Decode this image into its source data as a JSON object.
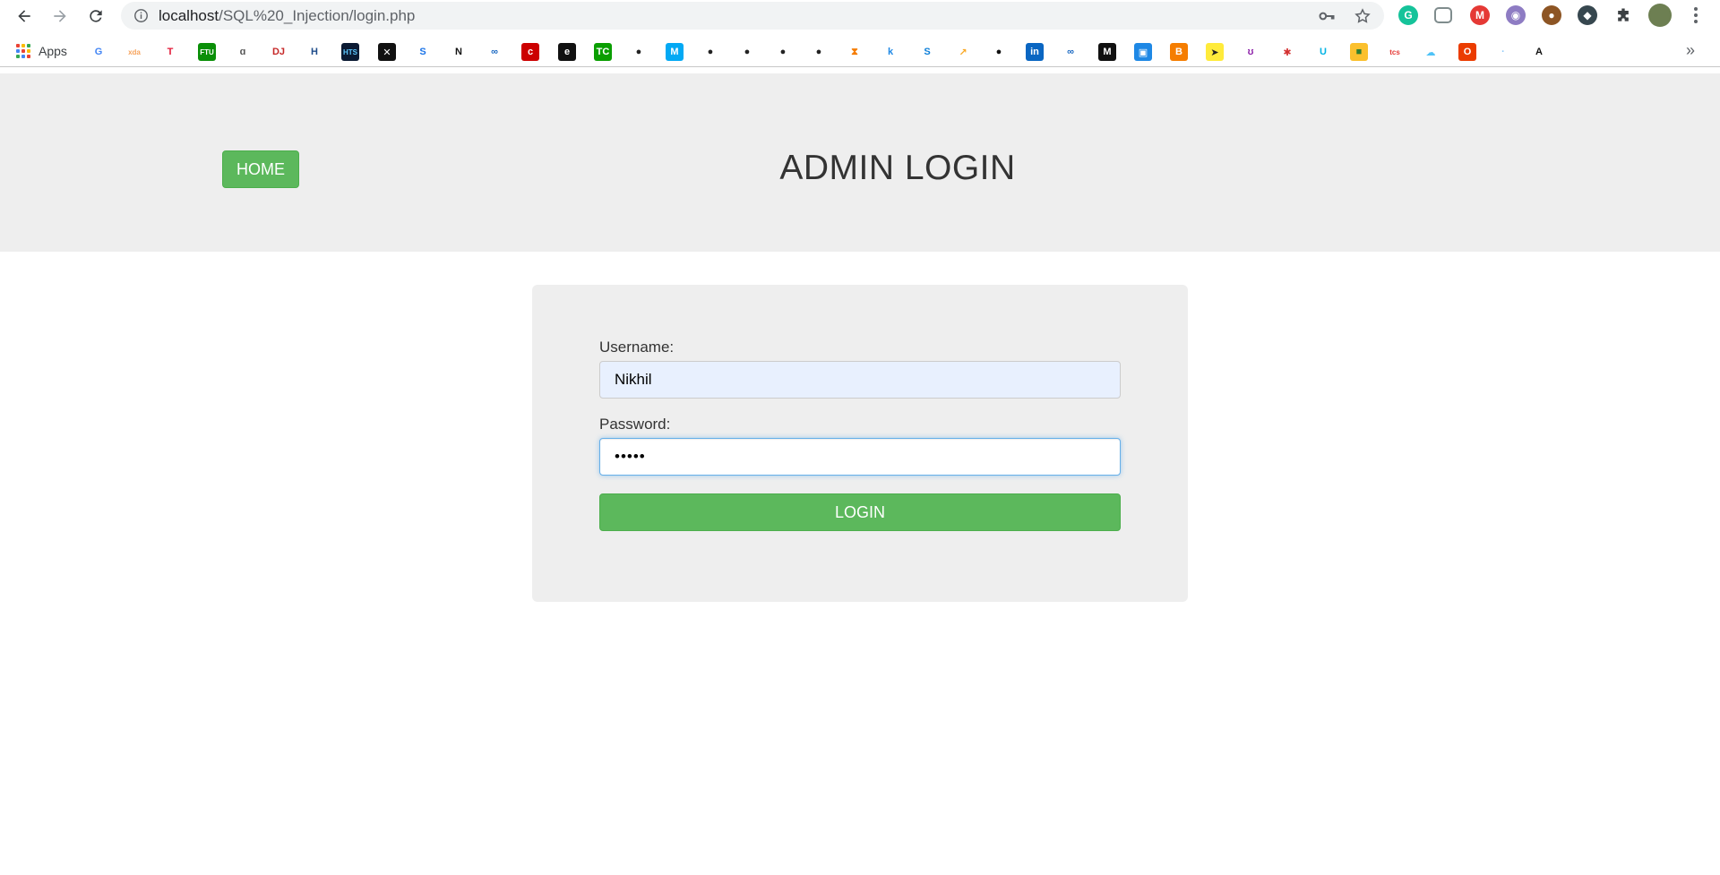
{
  "browser": {
    "url_host": "localhost",
    "url_path": "/SQL%20_Injection/login.php",
    "apps_label": "Apps",
    "more_label": "»"
  },
  "bookmarks": [
    {
      "name": "google",
      "glyph": "G",
      "bg": "#ffffff",
      "fg": "#4285f4"
    },
    {
      "name": "xda",
      "glyph": "xda",
      "bg": "#ffffff",
      "fg": "#f7a35c"
    },
    {
      "name": "tesla",
      "glyph": "T",
      "bg": "#ffffff",
      "fg": "#e31937"
    },
    {
      "name": "ftu",
      "glyph": "FTU",
      "bg": "#0a8f08",
      "fg": "#ffffff"
    },
    {
      "name": "grammarly-go",
      "glyph": "ɑ",
      "bg": "#ffffff",
      "fg": "#555555"
    },
    {
      "name": "dj",
      "glyph": "DJ",
      "bg": "#ffffff",
      "fg": "#c62828"
    },
    {
      "name": "h-tile",
      "glyph": "H",
      "bg": "#ffffff",
      "fg": "#1e4c8a"
    },
    {
      "name": "hts",
      "glyph": "HTS",
      "bg": "#0b1a33",
      "fg": "#5ec8ff"
    },
    {
      "name": "x-tile",
      "glyph": "✕",
      "bg": "#111111",
      "fg": "#ffffff"
    },
    {
      "name": "s-tile",
      "glyph": "S",
      "bg": "#ffffff",
      "fg": "#1a73e8"
    },
    {
      "name": "n-tile",
      "glyph": "N",
      "bg": "#ffffff",
      "fg": "#111111"
    },
    {
      "name": "infinity-1",
      "glyph": "∞",
      "bg": "#ffffff",
      "fg": "#1565c0"
    },
    {
      "name": "c-tile",
      "glyph": "c",
      "bg": "#cc0000",
      "fg": "#ffffff"
    },
    {
      "name": "e-tile",
      "glyph": "e",
      "bg": "#111111",
      "fg": "#ffffff"
    },
    {
      "name": "techcrunch",
      "glyph": "TC",
      "bg": "#0a9e01",
      "fg": "#ffffff"
    },
    {
      "name": "globe-1",
      "glyph": "●",
      "bg": "#ffffff",
      "fg": "#222222"
    },
    {
      "name": "m-tile",
      "glyph": "M",
      "bg": "#03a9f4",
      "fg": "#ffffff"
    },
    {
      "name": "globe-2",
      "glyph": "●",
      "bg": "#ffffff",
      "fg": "#222222"
    },
    {
      "name": "globe-3",
      "glyph": "●",
      "bg": "#ffffff",
      "fg": "#222222"
    },
    {
      "name": "globe-4",
      "glyph": "●",
      "bg": "#ffffff",
      "fg": "#222222"
    },
    {
      "name": "globe-5",
      "glyph": "●",
      "bg": "#ffffff",
      "fg": "#222222"
    },
    {
      "name": "hourglass",
      "glyph": "⧗",
      "bg": "#ffffff",
      "fg": "#f57c00"
    },
    {
      "name": "k-tile",
      "glyph": "k",
      "bg": "#ffffff",
      "fg": "#1e88e5"
    },
    {
      "name": "s-blue",
      "glyph": "S",
      "bg": "#ffffff",
      "fg": "#0d7fd8"
    },
    {
      "name": "arrow-tile",
      "glyph": "↗",
      "bg": "#ffffff",
      "fg": "#f9a825"
    },
    {
      "name": "github",
      "glyph": "●",
      "bg": "#ffffff",
      "fg": "#111111"
    },
    {
      "name": "linkedin",
      "glyph": "in",
      "bg": "#0a66c2",
      "fg": "#ffffff"
    },
    {
      "name": "infinity-2",
      "glyph": "∞",
      "bg": "#ffffff",
      "fg": "#1565c0"
    },
    {
      "name": "medium",
      "glyph": "M",
      "bg": "#111111",
      "fg": "#ffffff"
    },
    {
      "name": "id-tile",
      "glyph": "▣",
      "bg": "#1e88e5",
      "fg": "#ffffff"
    },
    {
      "name": "blogger",
      "glyph": "B",
      "bg": "#f57d00",
      "fg": "#ffffff"
    },
    {
      "name": "send-tile",
      "glyph": "➤",
      "bg": "#ffeb3b",
      "fg": "#222222"
    },
    {
      "name": "purple-tile",
      "glyph": "ʊ",
      "bg": "#ffffff",
      "fg": "#8e24aa"
    },
    {
      "name": "red-tile",
      "glyph": "✱",
      "bg": "#ffffff",
      "fg": "#d32f2f"
    },
    {
      "name": "udacity",
      "glyph": "U",
      "bg": "#ffffff",
      "fg": "#02b3e4"
    },
    {
      "name": "yellow-tile",
      "glyph": "■",
      "bg": "#fbc02d",
      "fg": "#2e7d32"
    },
    {
      "name": "tcs",
      "glyph": "tcs",
      "bg": "#ffffff",
      "fg": "#e53935"
    },
    {
      "name": "cloud-tile",
      "glyph": "☁",
      "bg": "#ffffff",
      "fg": "#4fc3f7"
    },
    {
      "name": "office",
      "glyph": "O",
      "bg": "#eb3c00",
      "fg": "#ffffff"
    },
    {
      "name": "blank-tile",
      "glyph": "·",
      "bg": "#ffffff",
      "fg": "#90caf9"
    },
    {
      "name": "a-tile",
      "glyph": "A",
      "bg": "#ffffff",
      "fg": "#111111"
    }
  ],
  "header": {
    "home_label": "HOME",
    "title": "ADMIN LOGIN"
  },
  "form": {
    "username_label": "Username:",
    "username_value": "Nikhil",
    "password_label": "Password:",
    "password_value": "•••••",
    "login_label": "LOGIN"
  },
  "colors": {
    "header_bg": "#eeeeee",
    "card_bg": "#eeeeee",
    "button_green": "#5cb85c",
    "autofill_bg": "#e8f0fe",
    "focus_border": "#66afe9"
  }
}
